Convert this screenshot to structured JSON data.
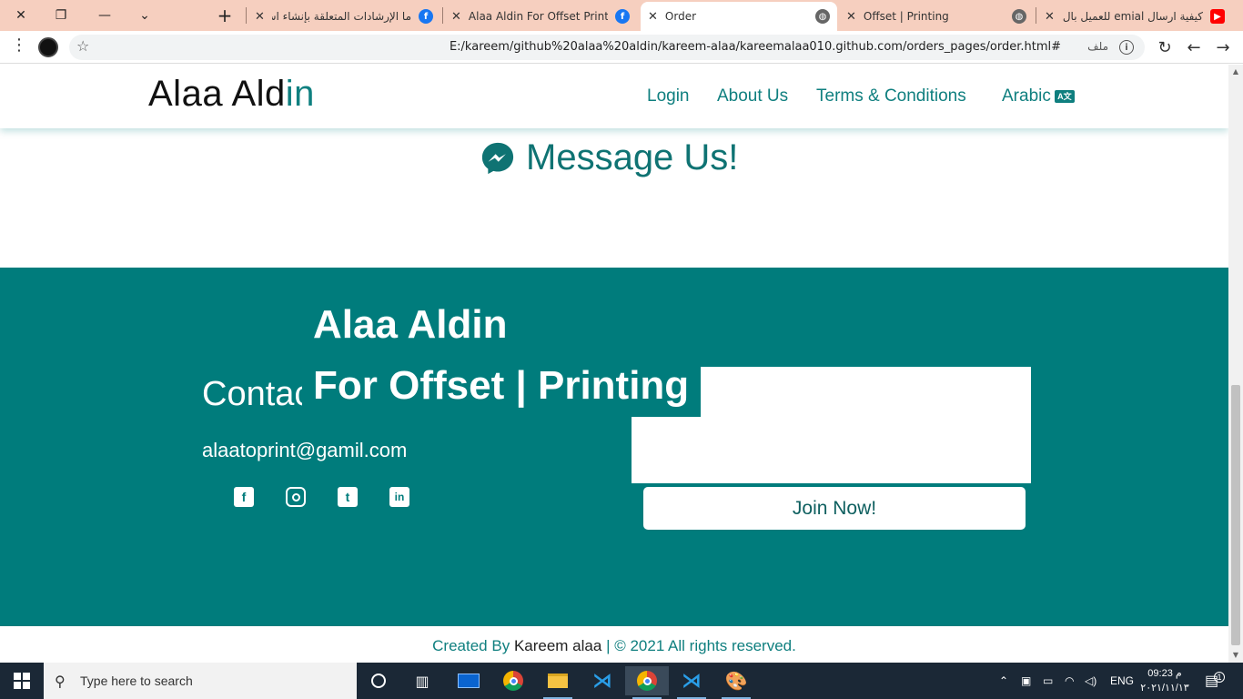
{
  "browser": {
    "tabs": [
      {
        "label": "كيفية ارسال emial للعميل بال",
        "favicon": "youtube-icon"
      },
      {
        "label": "Offset | Printing",
        "favicon": "globe-icon"
      },
      {
        "label": "Order",
        "favicon": "globe-icon",
        "active": true
      },
      {
        "label": "Alaa Aldin For Offset Printing",
        "favicon": "facebook-icon"
      },
      {
        "label": "ما الإرشادات المتعلقة بإنشاء اس",
        "favicon": "facebook-icon"
      }
    ],
    "url": "E:/kareem/github%20alaa%20aldin/kareem-alaa/kareemalaa010.github.com/orders_pages/order.html#",
    "file_label": "ملف"
  },
  "site": {
    "brand_main": "Alaa Ald",
    "brand_accent": "in",
    "nav": {
      "login": "Login",
      "about": "About Us",
      "terms": "Terms & Conditions",
      "arabic": "Arabic"
    },
    "message_title": "Message Us!",
    "footer": {
      "contact_heading": "Contact",
      "company_line1": "Alaa Aldin",
      "company_line2": "For Offset | Printing",
      "email": "alaatoprint@gamil.com",
      "join_button": "Join Now!",
      "credit_prefix": "Created By",
      "credit_author": "Kareem alaa",
      "credit_suffix": "| © 2021 All rights reserved."
    },
    "colors": {
      "accent": "#007c7c",
      "tab_strip": "#f6cfbf"
    }
  },
  "taskbar": {
    "search_placeholder": "Type here to search",
    "language": "ENG",
    "time": "09:23 م",
    "date": "٢٠٢١/١١/١٣",
    "notification_count": "1"
  }
}
